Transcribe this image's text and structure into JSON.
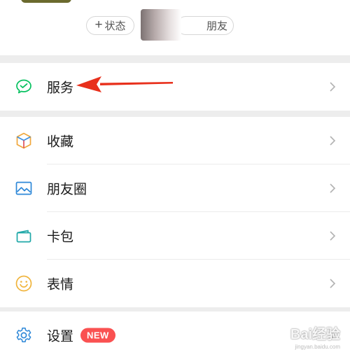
{
  "profile": {
    "status_chip": {
      "icon": "plus-icon",
      "label": "状态"
    },
    "friend_chip": {
      "label": "朋友"
    }
  },
  "sections": [
    {
      "items": [
        {
          "label": "服务",
          "icon": "wechat-pay-icon"
        }
      ]
    },
    {
      "items": [
        {
          "label": "收藏",
          "icon": "favorites-cube-icon"
        },
        {
          "label": "朋友圈",
          "icon": "moments-photo-icon"
        },
        {
          "label": "卡包",
          "icon": "card-wallet-icon"
        },
        {
          "label": "表情",
          "icon": "smiley-icon"
        }
      ]
    },
    {
      "items": [
        {
          "label": "设置",
          "icon": "gear-icon",
          "badge": "NEW"
        }
      ]
    }
  ],
  "annotation": {
    "type": "red-arrow",
    "color": "#e8301c",
    "points_to": "服务"
  },
  "watermark": {
    "text": "Bai经验",
    "sub": "jingyan.baidu.com"
  },
  "colors": {
    "accent_green": "#07c160",
    "badge_red": "#fa5151",
    "background": "#ededed"
  }
}
